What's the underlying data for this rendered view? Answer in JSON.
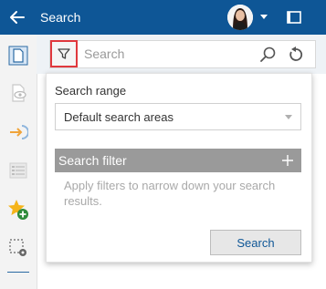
{
  "header": {
    "title": "Search",
    "back_icon": "arrow-left-icon",
    "window_icon": "window-restore-icon",
    "accent_color": "#0e5696"
  },
  "toolbar": {
    "filter_icon": "funnel-icon",
    "search_placeholder": "Search",
    "search_value": "",
    "search_icon": "magnifier-icon",
    "reset_icon": "undo-icon"
  },
  "sidebar": {
    "items": [
      {
        "icon": "document-icon",
        "active": true
      },
      {
        "icon": "document-eye-icon",
        "active": false
      },
      {
        "icon": "arrow-into-icon",
        "active": false
      },
      {
        "icon": "list-icon",
        "active": false
      },
      {
        "icon": "star-add-icon",
        "active": false
      },
      {
        "icon": "selection-settings-icon",
        "active": false
      }
    ]
  },
  "panel": {
    "range_label": "Search range",
    "range_value": "Default search areas",
    "filter_header": "Search filter",
    "filter_hint": "Apply filters to narrow down your search results.",
    "search_button": "Search"
  }
}
